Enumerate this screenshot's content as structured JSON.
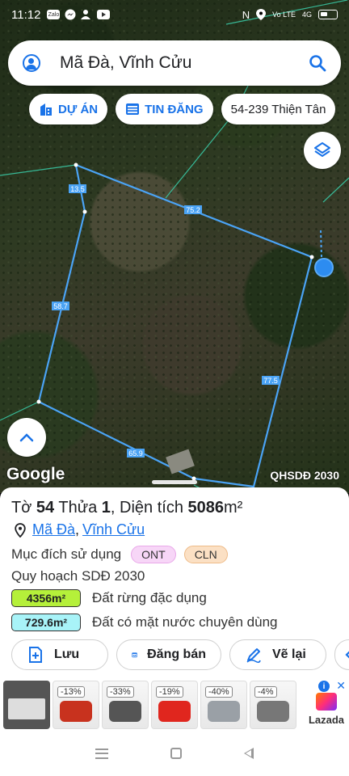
{
  "status_bar": {
    "time": "11:12",
    "net": "Vo LTE",
    "signal": "4G"
  },
  "search": {
    "query": "Mã Đà, Vĩnh Cửu"
  },
  "chips": {
    "du_an": "DỰ ÁN",
    "tin_dang": "TIN ĐĂNG",
    "parcel": "54-239 Thiện Tân"
  },
  "map": {
    "edge_labels": {
      "e1": "13.5",
      "e2": "75.2",
      "e3": "58.7",
      "e4": "77.5",
      "e5": "65.9"
    },
    "attribution": "Google",
    "layer_name": "QHSDĐ 2030"
  },
  "parcel": {
    "to_label": "Tờ",
    "to_num": "54",
    "thua_label": "Thửa",
    "thua_num": "1",
    "dien_tich_label": ", Diện tích",
    "area": "5086",
    "unit": "m²",
    "commune": "Mã Đà",
    "sep": ",",
    "district": "Vĩnh Cửu",
    "purpose_label": "Mục đích sử dụng",
    "purposes": [
      "ONT",
      "CLN"
    ],
    "purpose_colors": [
      "#f7d6f7",
      "#fbe0c4"
    ],
    "plan_label": "Quy hoạch SDĐ 2030",
    "plans": [
      {
        "area": "4356m²",
        "label": "Đất rừng đặc dụng",
        "color": "#b5f03a"
      },
      {
        "area": "729.6m²",
        "label": "Đất có mặt nước chuyên dùng",
        "color": "#a8f3f8"
      }
    ]
  },
  "actions": {
    "save": "Lưu",
    "post": "Đăng bán",
    "redraw": "Vẽ lại"
  },
  "ads": {
    "discounts": [
      "-13%",
      "-33%",
      "-19%",
      "-40%",
      "-4%"
    ],
    "brand": "Lazada",
    "info": "i",
    "close": "✕"
  },
  "colors": {
    "accent": "#1a73e8",
    "parcel_line": "#4aa3f5"
  }
}
